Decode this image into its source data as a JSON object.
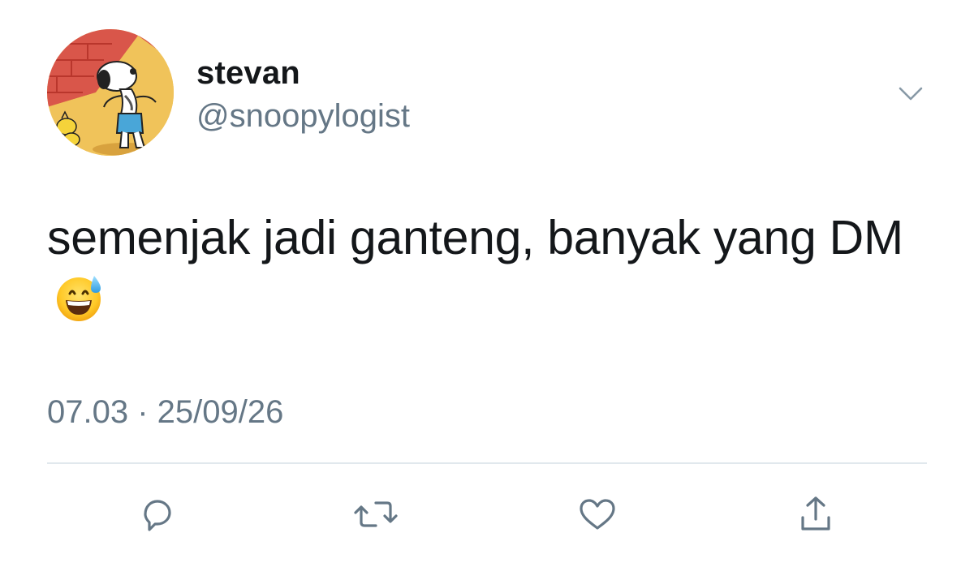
{
  "user": {
    "display_name": "stevan",
    "handle": "@snoopylogist",
    "avatar_icon": "snoopy-avatar"
  },
  "tweet": {
    "text": "semenjak jadi ganteng, banyak yang DM",
    "emoji": "smiling-face-with-open-mouth-and-cold-sweat",
    "timestamp": "07.03 · 25/09/26"
  },
  "actions": {
    "reply_icon": "reply-icon",
    "retweet_icon": "retweet-icon",
    "like_icon": "heart-icon",
    "share_icon": "share-icon"
  },
  "colors": {
    "primary_text": "#14171a",
    "secondary_text": "#657786",
    "icon": "#657786",
    "divider": "#e1e8ed"
  }
}
